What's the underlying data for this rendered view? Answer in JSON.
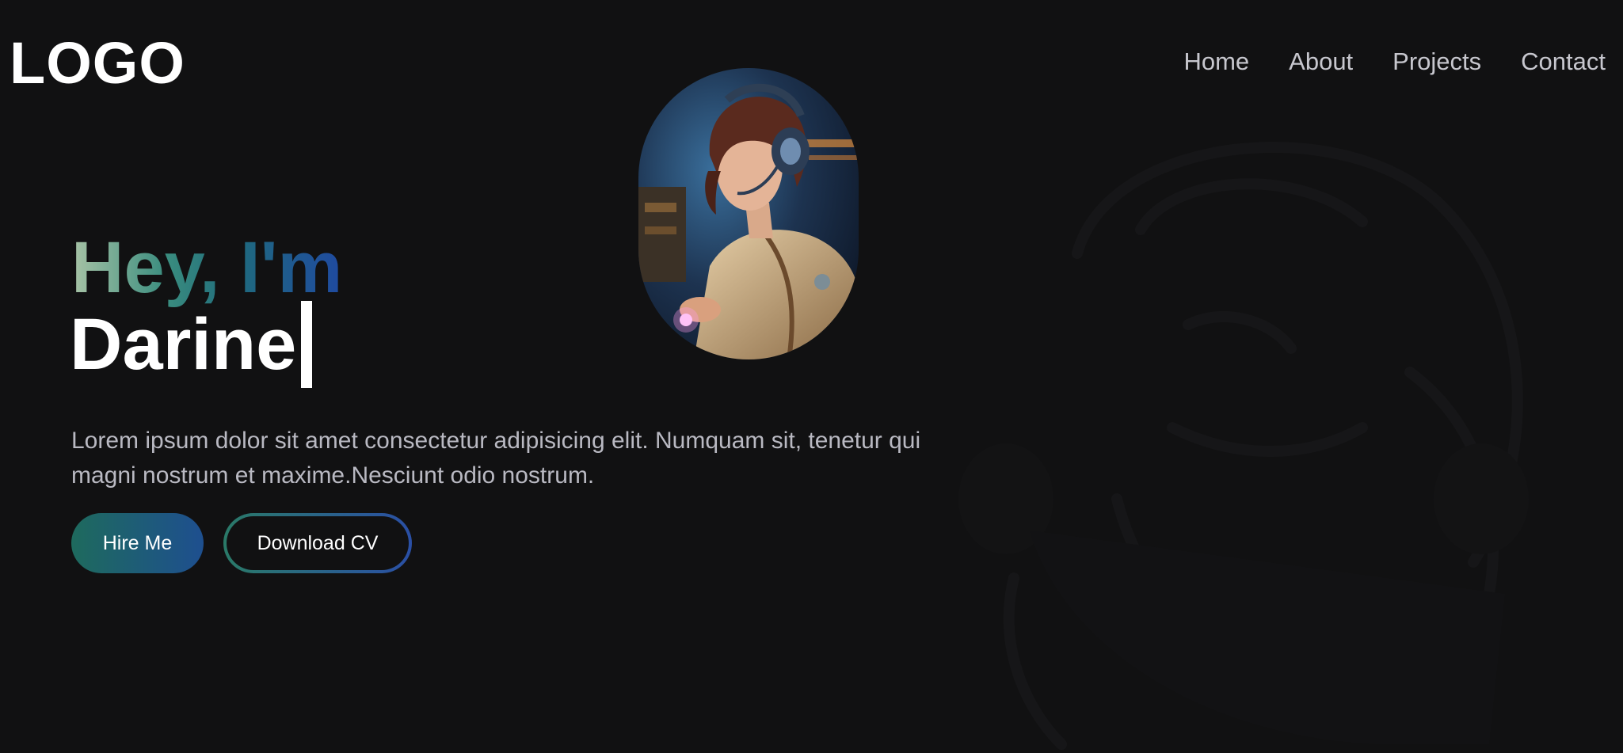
{
  "header": {
    "logo": "LOGO",
    "nav": [
      {
        "label": "Home"
      },
      {
        "label": "About"
      },
      {
        "label": "Projects"
      },
      {
        "label": "Contact"
      }
    ]
  },
  "hero": {
    "greeting": "Hey, I'm",
    "name": "Darine",
    "description": "Lorem ipsum dolor sit amet consectetur adipisicing elit. Numquam sit, tenetur qui magni nostrum et maxime.Nesciunt odio nostrum.",
    "buttons": {
      "hire": "Hire Me",
      "download": "Download CV"
    }
  },
  "colors": {
    "background": "#111112",
    "accent_green": "#1e6a5d",
    "accent_blue": "#1e4f8f",
    "text_muted": "#b9b9c2"
  }
}
